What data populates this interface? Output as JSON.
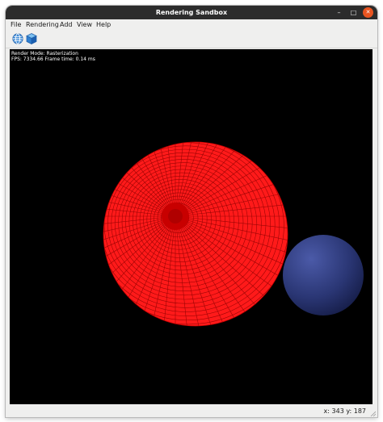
{
  "window": {
    "title": "Rendering Sandbox",
    "minimize_glyph": "–",
    "maximize_glyph": "□",
    "close_glyph": "✕"
  },
  "menu": [
    "File",
    "Rendering",
    "Add",
    "View",
    "Help"
  ],
  "toolbar": {
    "buttons": [
      {
        "icon": "globe-icon"
      },
      {
        "icon": "cube-icon"
      }
    ]
  },
  "viewport": {
    "render_mode": "Render Mode: Rasterization",
    "stats": "FPS: 7334.66 Frame time: 0.14 ms",
    "background_color": "#000000",
    "spheres": [
      {
        "name": "red-sphere",
        "color": "#ff1a1a",
        "wireframe_color": "#8a0000"
      },
      {
        "name": "blue-sphere",
        "color": "#2d3a7a"
      }
    ]
  },
  "status": {
    "coords": "x: 343 y: 187"
  },
  "colors": {
    "titlebar": "#2c2c2c",
    "close_button": "#e95420",
    "chrome": "#efefee"
  }
}
